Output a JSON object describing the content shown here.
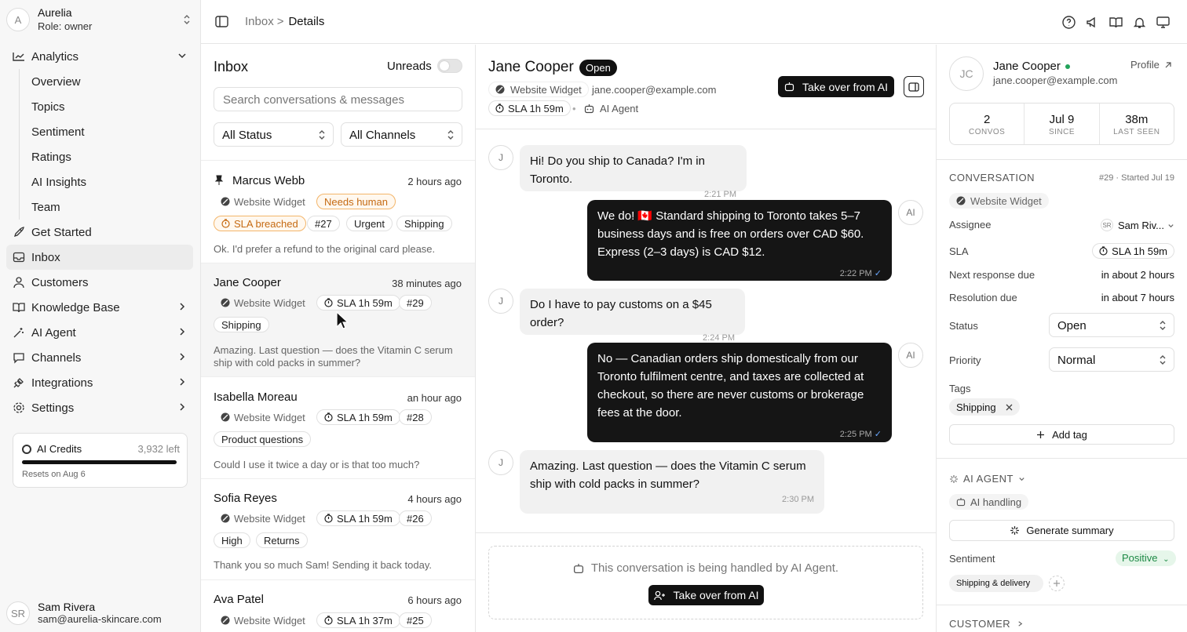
{
  "workspace": {
    "name": "Aurelia",
    "role": "Role: owner",
    "initial": "A"
  },
  "nav": {
    "analytics": "Analytics",
    "sub": [
      "Overview",
      "Topics",
      "Sentiment",
      "Ratings",
      "AI Insights",
      "Team"
    ],
    "get_started": "Get Started",
    "inbox": "Inbox",
    "customers": "Customers",
    "knowledge": "Knowledge Base",
    "ai_agent": "AI Agent",
    "channels": "Channels",
    "integrations": "Integrations",
    "settings": "Settings"
  },
  "credits": {
    "label": "AI Credits",
    "left": "3,932 left",
    "reset": "Resets on Aug 6",
    "fill_fraction": 1.0
  },
  "user": {
    "initials": "SR",
    "name": "Sam Rivera",
    "email": "sam@aurelia-skincare.com"
  },
  "breadcrumb": {
    "parent": "Inbox",
    "current": "Details",
    "sep": ">"
  },
  "inbox": {
    "title": "Inbox",
    "unreads": "Unreads",
    "search_placeholder": "Search conversations & messages",
    "status_filter": "All Status",
    "channel_filter": "All Channels",
    "conversations": [
      {
        "name": "Marcus Webb",
        "time": "2 hours ago",
        "channel": "Website Widget",
        "needs": "Needs human",
        "sla": "SLA breached",
        "num": "#27",
        "tags": [
          "Urgent",
          "Shipping"
        ],
        "preview": "Ok. I'd prefer a refund to the original card please."
      },
      {
        "name": "Jane Cooper",
        "time": "38 minutes ago",
        "channel": "Website Widget",
        "sla": "SLA 1h 59m",
        "num": "#29",
        "tags": [
          "Shipping"
        ],
        "preview": "Amazing. Last question — does the Vitamin C serum ship with cold packs in summer?"
      },
      {
        "name": "Isabella Moreau",
        "time": "an hour ago",
        "channel": "Website Widget",
        "sla": "SLA 1h 59m",
        "num": "#28",
        "tags": [
          "Product questions"
        ],
        "preview": "Could I use it twice a day or is that too much?"
      },
      {
        "name": "Sofia Reyes",
        "time": "4 hours ago",
        "channel": "Website Widget",
        "sla": "SLA 1h 59m",
        "num": "#26",
        "tags": [
          "High",
          "Returns"
        ],
        "preview": "Thank you so much Sam! Sending it back today."
      },
      {
        "name": "Ava Patel",
        "time": "6 hours ago",
        "channel": "Website Widget",
        "sla": "SLA 1h 37m",
        "num": "#25"
      }
    ]
  },
  "chat": {
    "name": "Jane Cooper",
    "status": "Open",
    "channel": "Website Widget",
    "email": "jane.cooper@example.com",
    "sla": "SLA 1h 59m",
    "agent": "AI Agent",
    "take_over": "Take over from AI",
    "messages": [
      {
        "from": "J",
        "text": "Hi! Do you ship to Canada? I'm in Toronto.",
        "time": "2:21 PM"
      },
      {
        "from": "AI",
        "text": "We do! 🇨🇦 Standard shipping to Toronto takes 5–7 business days and is free on orders over CAD $60. Express (2–3 days) is CAD $12.",
        "time": "2:22 PM"
      },
      {
        "from": "J",
        "text": "Do I have to pay customs on a $45 order?",
        "time": "2:24 PM"
      },
      {
        "from": "AI",
        "text": "No — Canadian orders ship domestically from our Toronto fulfilment centre, and taxes are collected at checkout, so there are never customs or brokerage fees at the door.",
        "time": "2:25 PM"
      },
      {
        "from": "J",
        "text": "Amazing. Last question — does the Vitamin C serum ship with cold packs in summer?",
        "time": "2:30 PM"
      }
    ],
    "handled": "This conversation is being handled by AI Agent.",
    "take_over_bottom": "Take over from AI"
  },
  "panel": {
    "initials": "JC",
    "name": "Jane Cooper",
    "email": "jane.cooper@example.com",
    "profile": "Profile",
    "stats": [
      {
        "v": "2",
        "l": "CONVOS"
      },
      {
        "v": "Jul 9",
        "l": "SINCE"
      },
      {
        "v": "38m",
        "l": "LAST SEEN"
      }
    ],
    "conversation": "CONVERSATION",
    "conv_meta": "#29 · Started Jul 19",
    "channel": "Website Widget",
    "assignee_label": "Assignee",
    "assignee_initials": "SR",
    "assignee": "Sam Riv...",
    "sla_label": "SLA",
    "sla": "SLA 1h 59m",
    "next_label": "Next response due",
    "next": "in about 2 hours",
    "res_label": "Resolution due",
    "res": "in about 7 hours",
    "status_label": "Status",
    "status": "Open",
    "priority_label": "Priority",
    "priority": "Normal",
    "tags_label": "Tags",
    "tag": "Shipping",
    "add_tag": "Add tag",
    "ai_agent": "AI AGENT",
    "ai_handling": "AI handling",
    "generate": "Generate summary",
    "sentiment_label": "Sentiment",
    "sentiment": "Positive",
    "topic": "Shipping & delivery",
    "customer": "CUSTOMER"
  }
}
